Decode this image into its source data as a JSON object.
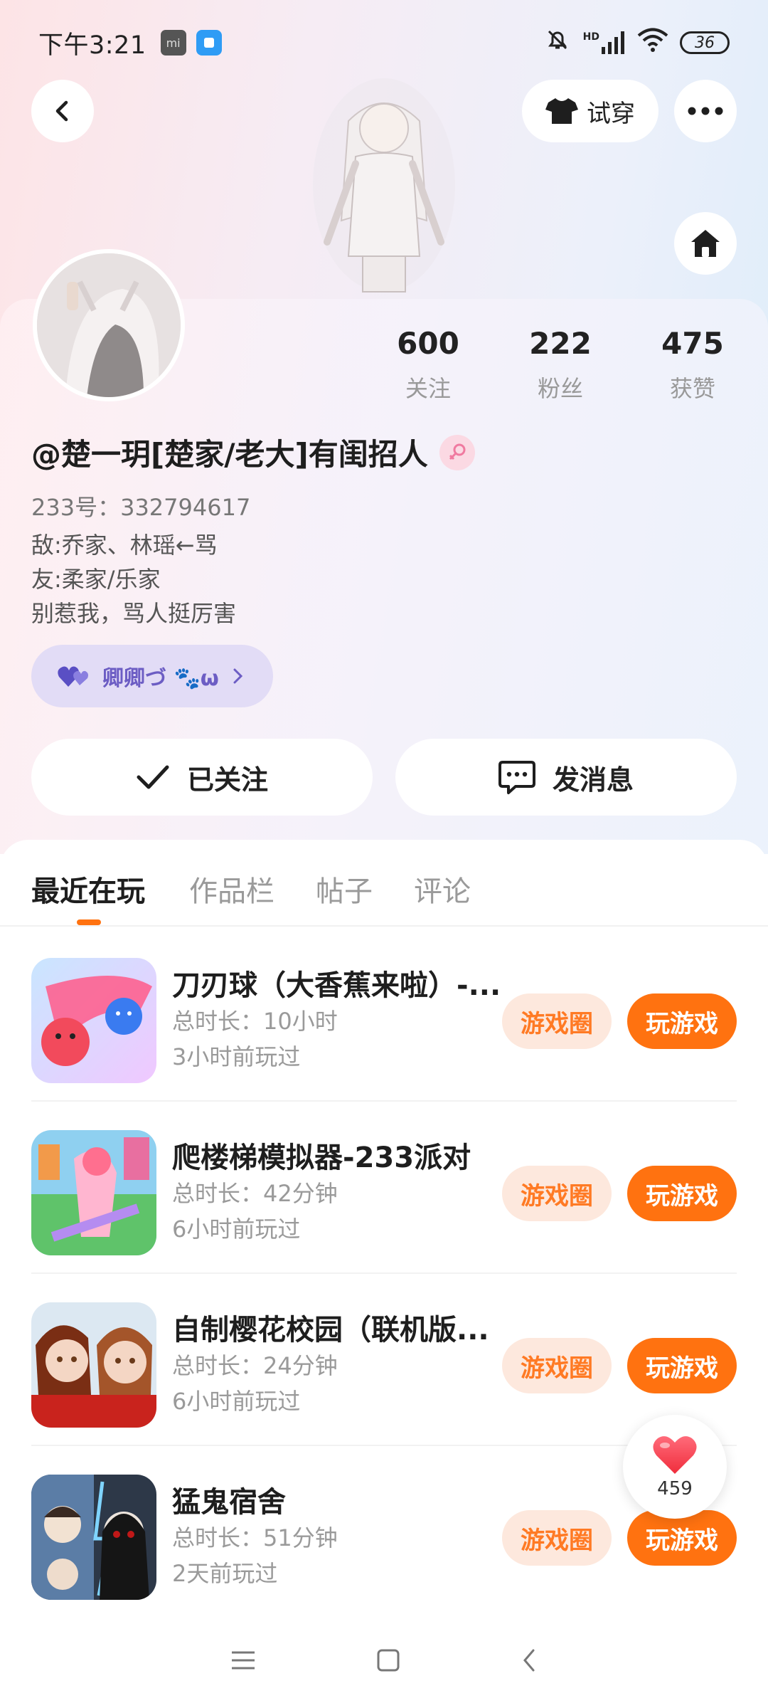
{
  "status_bar": {
    "time": "下午3:21",
    "network": "HD",
    "battery": "36"
  },
  "header": {
    "try_on_label": "试穿"
  },
  "profile": {
    "stats": [
      {
        "value": "600",
        "label": "关注"
      },
      {
        "value": "222",
        "label": "粉丝"
      },
      {
        "value": "475",
        "label": "获赞"
      }
    ],
    "nickname": "@楚一玥[楚家/老大]有闺招人",
    "uid": "233号：332794617",
    "bio": [
      "敌:乔家、林瑶←骂",
      "友:柔家/乐家",
      "别惹我，骂人挺厉害"
    ],
    "badge_text": "卿卿づ 🐾ω",
    "follow_label": "已关注",
    "message_label": "发消息"
  },
  "tabs": [
    "最近在玩",
    "作品栏",
    "帖子",
    "评论"
  ],
  "games": [
    {
      "title": "刀刃球（大香蕉来啦）-...",
      "duration": "总时长：10小时",
      "last_played": "3小时前玩过"
    },
    {
      "title": "爬楼梯模拟器-233派对",
      "duration": "总时长：42分钟",
      "last_played": "6小时前玩过"
    },
    {
      "title": "自制樱花校园（联机版...",
      "duration": "总时长：24分钟",
      "last_played": "6小时前玩过"
    },
    {
      "title": "猛鬼宿舍",
      "duration": "总时长：51分钟",
      "last_played": "2天前玩过"
    }
  ],
  "game_actions": {
    "circle": "游戏圈",
    "play": "玩游戏"
  },
  "like_count": "459",
  "colors": {
    "accent": "#ff7210",
    "pill_bg": "#fde8dd",
    "badge_bg": "#e2dcf6"
  }
}
